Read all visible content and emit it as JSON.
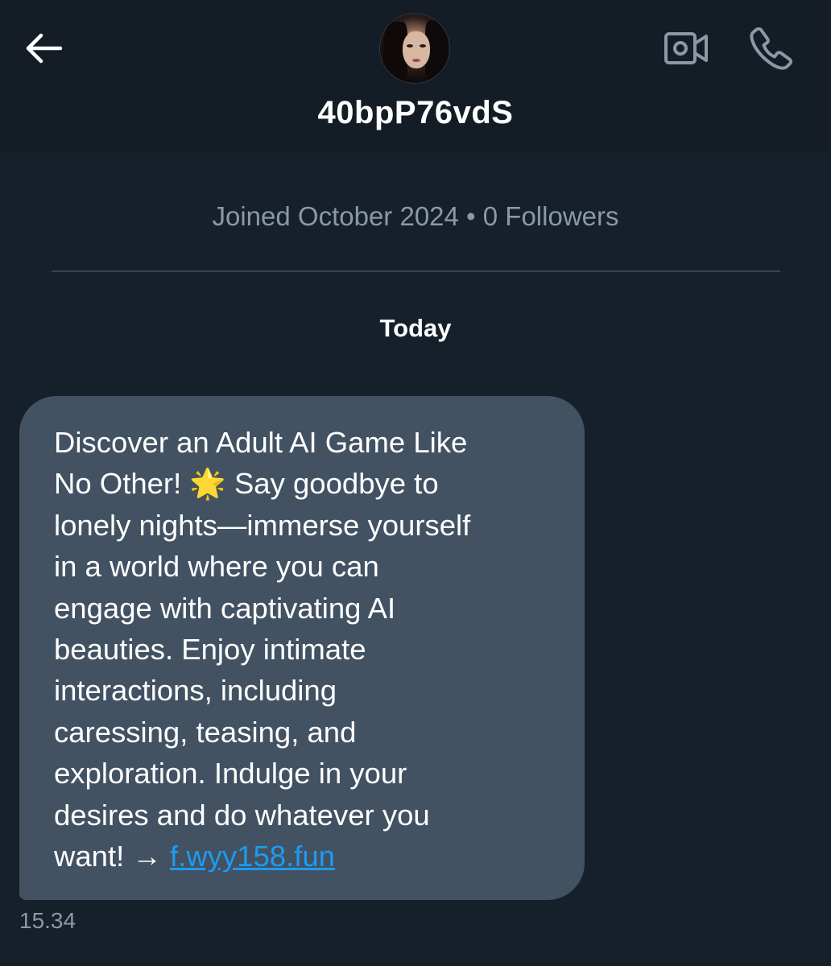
{
  "header": {
    "back_icon": "arrow-left-icon",
    "username": "40bpP76vdS",
    "video_icon": "video-camera-icon",
    "phone_icon": "phone-icon"
  },
  "profile": {
    "meta": "Joined October 2024 • 0 Followers"
  },
  "conversation": {
    "day_label": "Today",
    "messages": [
      {
        "text": "Discover an Adult AI Game Like\nNo Other! 🌟 Say goodbye to\nlonely nights—immerse yourself\nin a world where you can\nengage with captivating AI\nbeauties. Enjoy intimate\ninteractions, including\ncaressing, teasing, and\nexploration. Indulge in your\ndesires and do whatever you\nwant! → ",
        "link": "f.wyy158.fun",
        "time": "15.34"
      }
    ]
  },
  "colors": {
    "background": "#15202b",
    "bubble": "#425262",
    "link": "#1d9bf0",
    "muted_text": "#8b98a5"
  }
}
